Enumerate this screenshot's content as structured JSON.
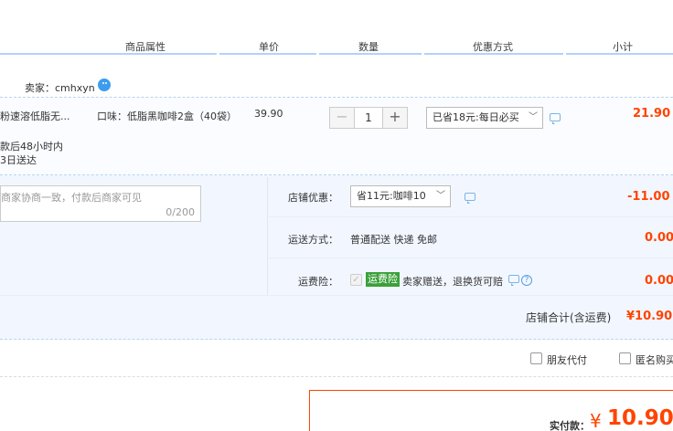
{
  "header": {
    "columns": [
      "商品属性",
      "单价",
      "数量",
      "优惠方式",
      "小计"
    ]
  },
  "seller": {
    "label": "卖家：cmhxyn"
  },
  "item": {
    "title": "粉速溶低脂无...",
    "attribute": "口味：低脂黑咖啡2盒（40袋）",
    "price": "39.90",
    "quantity": "1",
    "minus": "−",
    "plus": "+",
    "discount_select": "已省18元:每日必买",
    "subtotal": "21.90",
    "delivery_line1": "款后48小时内",
    "delivery_line2": "3日送达"
  },
  "message": {
    "placeholder": "商家协商一致，付款后商家可见",
    "counter": "0/200"
  },
  "shop": {
    "discount_label": "店铺优惠：",
    "discount_select": "省11元:咖啡10",
    "discount_amount": "-11.00",
    "shipping_label": "运送方式：",
    "shipping_value": "普通配送 快递 免邮",
    "shipping_amount": "0.00",
    "insurance_label": "运费险：",
    "insurance_tag": "运费险",
    "insurance_text": "卖家赠送，退换货可赔",
    "insurance_amount": "0.00",
    "total_label": "店铺合计(含运费)",
    "total_value": "¥10.90"
  },
  "options": {
    "friend_pay": "朋友代付",
    "anonymous": "匿名购买"
  },
  "payment": {
    "label": "实付款：",
    "currency": "¥",
    "amount": "10.90"
  },
  "colors": {
    "accent": "#ff4400",
    "header_line": "#b2d1ff",
    "panel_bg": "#f2f7ff"
  }
}
